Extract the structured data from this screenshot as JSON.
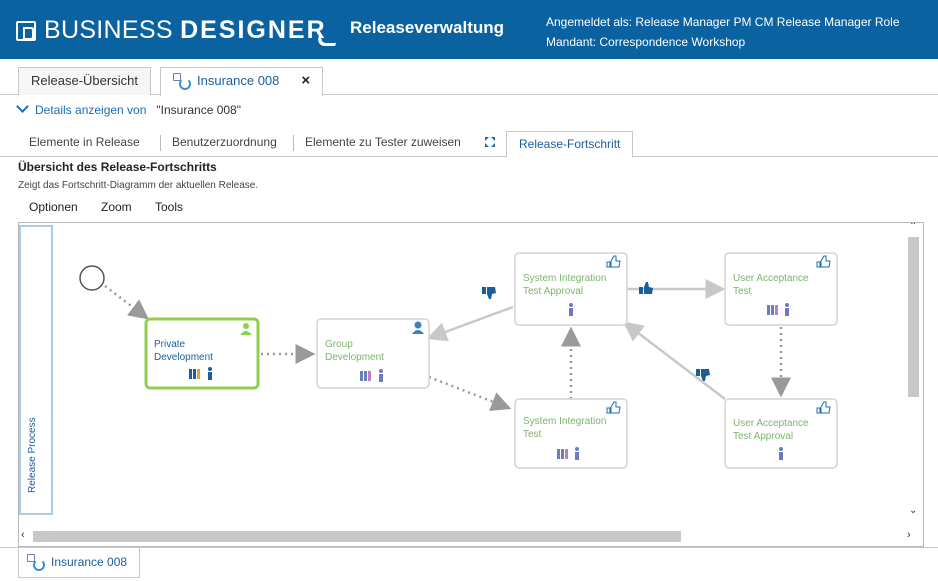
{
  "header": {
    "brand_light": "BUSINESS",
    "brand_bold": "DESIGNER",
    "app_title": "Releaseverwaltung",
    "user_line": "Angemeldet als: Release Manager   PM CM Release Manager Role",
    "tenant_line": "Mandant: Correspondence Workshop",
    "bg_color": "#0a62a0"
  },
  "tabs": [
    {
      "label": "Release-Übersicht",
      "active": false
    },
    {
      "label": "Insurance 008",
      "active": true,
      "closable": true,
      "close_label": "×"
    }
  ],
  "details": {
    "link": "Details anzeigen von",
    "value": "\"Insurance 008\""
  },
  "subtabs": [
    {
      "label": "Elemente in Release"
    },
    {
      "label": "Benutzerzuordnung"
    },
    {
      "label": "Elemente zu Tester zuweisen"
    },
    {
      "label": "Release-Fortschritt",
      "active": true
    }
  ],
  "section": {
    "title": "Übersicht des Release-Fortschritts",
    "subtitle": "Zeigt das Fortschritt-Diagramm der aktuellen Release."
  },
  "menu": [
    "Optionen",
    "Zoom",
    "Tools"
  ],
  "diagram": {
    "lane_label": "Release Process",
    "nodes": [
      {
        "id": "private",
        "lines": [
          "Private",
          "Development"
        ],
        "active": true
      },
      {
        "id": "group",
        "lines": [
          "Group",
          "Development"
        ]
      },
      {
        "id": "sit_approval",
        "lines": [
          "System Integration",
          "Test Approval"
        ]
      },
      {
        "id": "sit",
        "lines": [
          "System Integration",
          "Test"
        ]
      },
      {
        "id": "uat",
        "lines": [
          "User Acceptance",
          "Test"
        ]
      },
      {
        "id": "uat_approval",
        "lines": [
          "User Acceptance",
          "Test Approval"
        ]
      }
    ],
    "active_color": "#8fd14f",
    "accent_color": "#1a6db5"
  },
  "bottom_tab": {
    "label": "Insurance 008"
  }
}
